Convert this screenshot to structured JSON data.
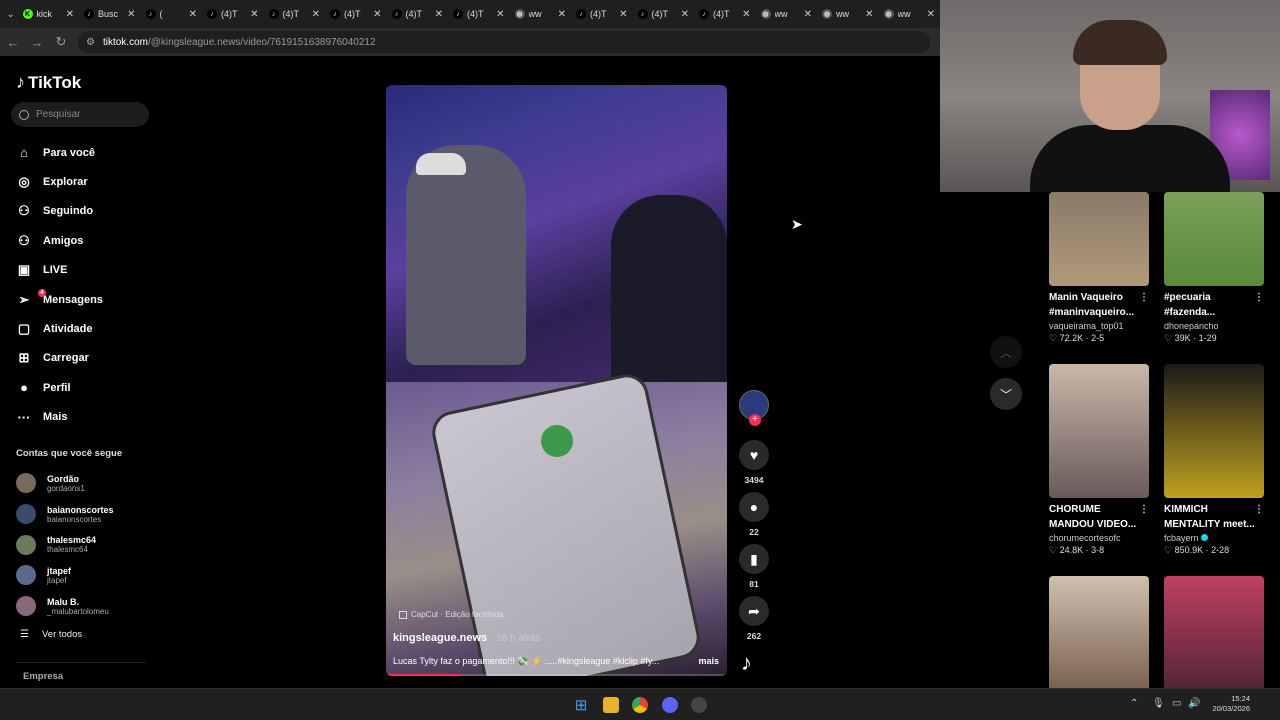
{
  "browser": {
    "tabs": [
      {
        "label": "kick",
        "icon": "kick-icon",
        "color": "#53fc18"
      },
      {
        "label": "Busc",
        "icon": "tiktok-icon",
        "color": "#000000"
      },
      {
        "label": "(",
        "icon": "tiktok-icon",
        "color": "#000000"
      },
      {
        "label": "(4)T",
        "icon": "tiktok-icon",
        "color": "#000000"
      },
      {
        "label": "(4)T",
        "icon": "tiktok-icon",
        "color": "#000000"
      },
      {
        "label": "(4)T",
        "icon": "tiktok-icon",
        "color": "#000000"
      },
      {
        "label": "(4)T",
        "icon": "tiktok-icon",
        "color": "#000000"
      },
      {
        "label": "(4)T",
        "icon": "tiktok-icon",
        "color": "#000000"
      },
      {
        "label": "ww",
        "icon": "globe-icon",
        "color": "#555555"
      },
      {
        "label": "(4)T",
        "icon": "tiktok-icon",
        "color": "#000000"
      },
      {
        "label": "(4)T",
        "icon": "tiktok-icon",
        "color": "#000000"
      },
      {
        "label": "(4)T",
        "icon": "tiktok-icon",
        "color": "#000000"
      },
      {
        "label": "ww",
        "icon": "globe-icon",
        "color": "#555555"
      },
      {
        "label": "ww",
        "icon": "globe-icon",
        "color": "#555555"
      },
      {
        "label": "ww",
        "icon": "globe-icon",
        "color": "#555555"
      }
    ],
    "url_domain": "tiktok.com",
    "url_path": "/@kingsleague.news/video/7619151638976040212"
  },
  "sidebar": {
    "logo": "TikTok",
    "search_placeholder": "Pesquisar",
    "nav": [
      {
        "label": "Para você",
        "icon": "home-icon",
        "glyph": "⌂"
      },
      {
        "label": "Explorar",
        "icon": "compass-icon",
        "glyph": "◎"
      },
      {
        "label": "Seguindo",
        "icon": "following-icon",
        "glyph": "⚇"
      },
      {
        "label": "Amigos",
        "icon": "friends-icon",
        "glyph": "⚇"
      },
      {
        "label": "LIVE",
        "icon": "live-icon",
        "glyph": "▣"
      },
      {
        "label": "Mensagens",
        "icon": "messages-icon",
        "glyph": "➢",
        "badge": "4"
      },
      {
        "label": "Atividade",
        "icon": "activity-icon",
        "glyph": "▢"
      },
      {
        "label": "Carregar",
        "icon": "upload-icon",
        "glyph": "⊞"
      },
      {
        "label": "Perfil",
        "icon": "profile-icon",
        "glyph": "●"
      },
      {
        "label": "Mais",
        "icon": "more-icon",
        "glyph": "···"
      }
    ],
    "following_title": "Contas que você segue",
    "accounts": [
      {
        "name": "Gordão",
        "handle": "gordaons1"
      },
      {
        "name": "baianonscortes",
        "handle": "baianonscortes"
      },
      {
        "name": "thalesmc64",
        "handle": "thalesmc64"
      },
      {
        "name": "jtapef",
        "handle": "jtapef"
      },
      {
        "name": "Malu B.",
        "handle": "_malubartolomeu"
      }
    ],
    "see_all": "Ver todos",
    "footer": "Empresa"
  },
  "video": {
    "capcut_label": "CapCut · Edição facilitada",
    "author": "kingsleague.news",
    "time": " · 16 h atrás",
    "description": "Lucas Tylty faz o pagamento!!! 💸 ⚡ .....#kingsleague #klclip #fy...",
    "more": "mais",
    "progress": 0.22,
    "likes": "3494",
    "comments": "22",
    "saves": "81",
    "shares": "262"
  },
  "feed": [
    {
      "title": "Manin Vaqueiro",
      "title2": "#maninvaqueiro...",
      "user": "vaqueirama_top01",
      "likes": "72.2K",
      "date": "2-5",
      "verified": false
    },
    {
      "title": "#pecuaria",
      "title2": "#fazenda...",
      "user": "dhonepancho",
      "likes": "39K",
      "date": "1-29",
      "verified": false
    },
    {
      "title": "CHORUME",
      "title2": "MANDOU VIDEO...",
      "user": "chorumecortesofc",
      "likes": "24.8K",
      "date": "3-8",
      "verified": false
    },
    {
      "title": "KIMMICH",
      "title2": "MENTALITY meet...",
      "user": "fcbayern",
      "likes": "850.9K",
      "date": "2-28",
      "verified": true
    },
    {
      "title": "",
      "title2": "",
      "user": "",
      "likes": "",
      "date": "",
      "verified": false
    },
    {
      "title": "",
      "title2": "",
      "user": "",
      "likes": "",
      "date": "",
      "verified": false
    }
  ],
  "taskbar": {
    "time": "15:24",
    "date": "20/03/2026"
  }
}
